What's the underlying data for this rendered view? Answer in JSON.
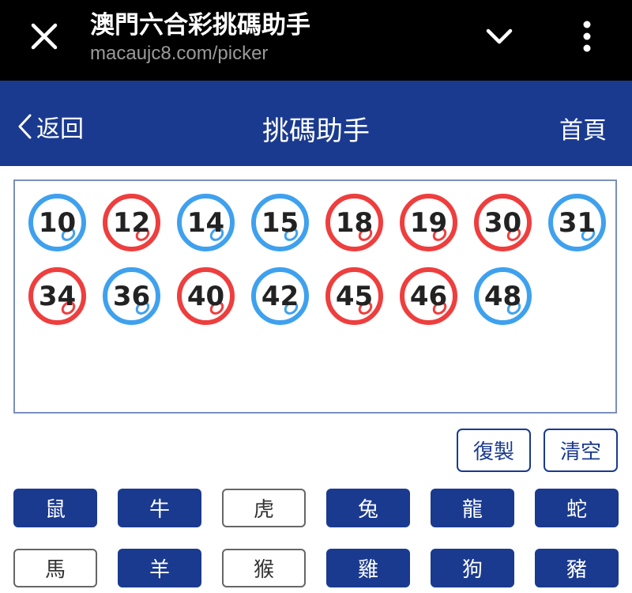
{
  "browser": {
    "title": "澳門六合彩挑碼助手",
    "url": "macaujc8.com/picker"
  },
  "header": {
    "back_label": "返回",
    "title": "挑碼助手",
    "home_label": "首頁",
    "background_color": "#1a3a8f"
  },
  "colors": {
    "red_ball": "#ee3e3e",
    "blue_ball": "#3fa1ee",
    "accent": "#1a3a8f"
  },
  "picked_numbers": [
    {
      "number": "10",
      "color": "blue"
    },
    {
      "number": "12",
      "color": "red"
    },
    {
      "number": "14",
      "color": "blue"
    },
    {
      "number": "15",
      "color": "blue"
    },
    {
      "number": "18",
      "color": "red"
    },
    {
      "number": "19",
      "color": "red"
    },
    {
      "number": "30",
      "color": "red"
    },
    {
      "number": "31",
      "color": "blue"
    },
    {
      "number": "34",
      "color": "red"
    },
    {
      "number": "36",
      "color": "blue"
    },
    {
      "number": "40",
      "color": "red"
    },
    {
      "number": "42",
      "color": "blue"
    },
    {
      "number": "45",
      "color": "red"
    },
    {
      "number": "46",
      "color": "red"
    },
    {
      "number": "48",
      "color": "blue"
    }
  ],
  "actions": {
    "copy_label": "復製",
    "clear_label": "清空"
  },
  "zodiac": [
    {
      "label": "鼠",
      "selected": true
    },
    {
      "label": "牛",
      "selected": true
    },
    {
      "label": "虎",
      "selected": false
    },
    {
      "label": "兔",
      "selected": true
    },
    {
      "label": "龍",
      "selected": true
    },
    {
      "label": "蛇",
      "selected": true
    },
    {
      "label": "馬",
      "selected": false
    },
    {
      "label": "羊",
      "selected": true
    },
    {
      "label": "猴",
      "selected": false
    },
    {
      "label": "雞",
      "selected": true
    },
    {
      "label": "狗",
      "selected": true
    },
    {
      "label": "豬",
      "selected": true
    }
  ]
}
